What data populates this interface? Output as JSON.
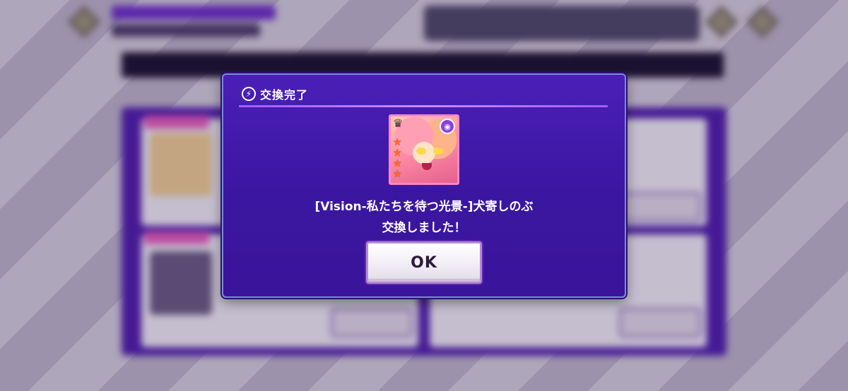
{
  "dialog": {
    "title": "交換完了",
    "message_line1": "[Vision-私たちを待つ光景-]犬寄しのぶ",
    "message_line2": "交換しました！",
    "ok_label": "OK"
  },
  "card": {
    "rarity_stars": 4,
    "icons": [
      "crown-icon",
      "attribute-icon",
      "star-icon"
    ]
  },
  "colors": {
    "modal_bg": "#4a1fb8",
    "modal_border": "#7a8bd8",
    "accent_rule": "#a05cff",
    "card_border": "#ff86c8",
    "star": "#ff6a2a"
  }
}
